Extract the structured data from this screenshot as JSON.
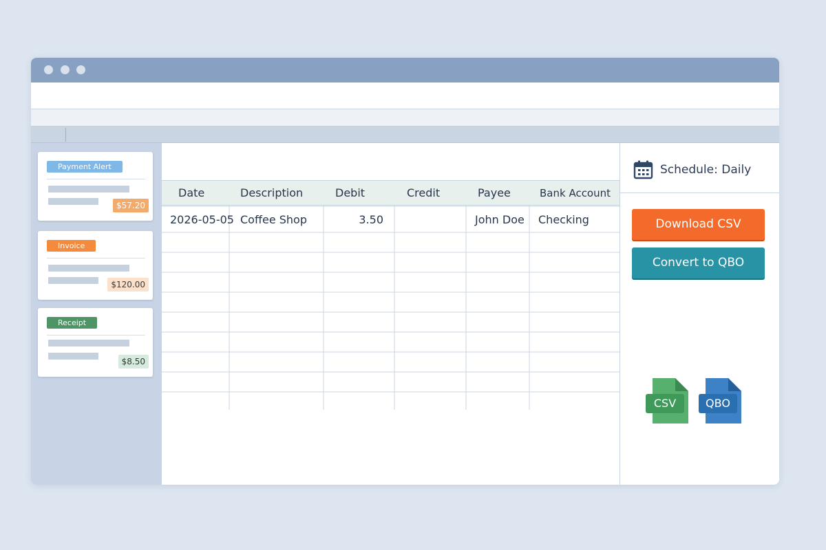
{
  "colors": {
    "background": "#dce5f0",
    "titlebar": "#88a0c2",
    "download_button": "#f46a2a",
    "convert_button": "#2893a5",
    "csv_icon": "#3f9a5a",
    "qbo_icon": "#2a6fb0"
  },
  "sidebar": {
    "cards": [
      {
        "tag": "Payment Alert",
        "tag_color": "#7fb8e6",
        "amount": "$57.20",
        "amount_bg": "#f2ab6b",
        "amount_color": "#ffffff"
      },
      {
        "tag": "Invoice",
        "tag_color": "#f48a3d",
        "amount": "$120.00",
        "amount_bg": "#fbe0cb",
        "amount_color": "#3a3a3a"
      },
      {
        "tag": "Receipt",
        "tag_color": "#4f9465",
        "amount": "$8.50",
        "amount_bg": "#d6ebde",
        "amount_color": "#2c3a30"
      }
    ]
  },
  "table": {
    "columns": [
      "Date",
      "Description",
      "Debit",
      "Credit",
      "Payee",
      "Bank Account"
    ],
    "rows": [
      [
        "2026-05-05",
        "Coffee Shop",
        "3.50",
        "",
        "John Doe",
        "Checking"
      ]
    ]
  },
  "schedule": {
    "icon": "calendar-icon",
    "label": "Schedule: Daily"
  },
  "actions": {
    "download_label": "Download CSV",
    "convert_label": "Convert to QBO"
  },
  "file_icons": [
    {
      "icon": "csv-file-icon",
      "label": "CSV"
    },
    {
      "icon": "qbo-file-icon",
      "label": "QBO"
    }
  ]
}
